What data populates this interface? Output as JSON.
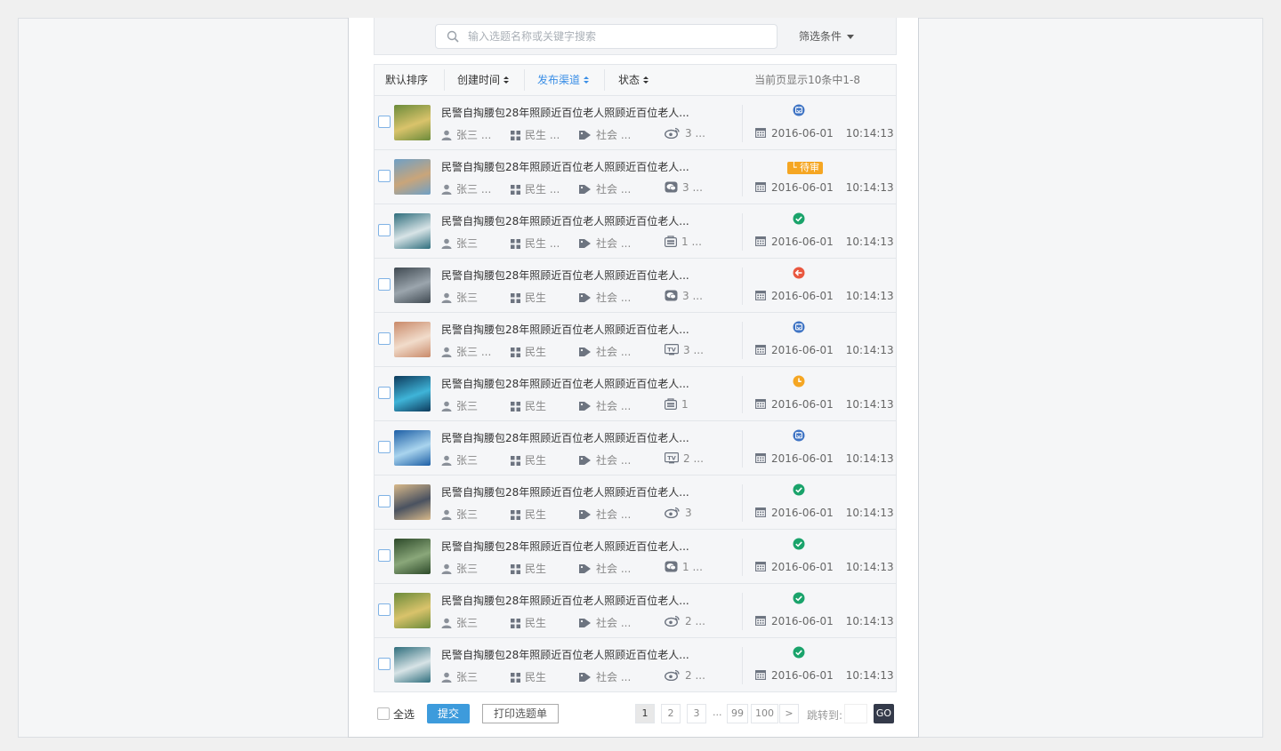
{
  "search": {
    "placeholder": "输入选题名称或关键字搜索"
  },
  "filter": {
    "label": "筛选条件"
  },
  "sort": {
    "default": "默认排序",
    "created": "创建时间",
    "channel": "发布渠道",
    "status": "状态",
    "page_info": "当前页显示10条中1-8"
  },
  "colors": {
    "accent": "#3d9bdc",
    "success": "#1aa36b",
    "warning": "#f5a623",
    "danger": "#e9573f",
    "info": "#3f74c4"
  },
  "rows": [
    {
      "title": "民警自掏腰包28年照顾近百位老人照顾近百位老人...",
      "author": "张三",
      "author_more": "...",
      "category": "民生",
      "category_more": "...",
      "tag": "社会",
      "tag_more": "...",
      "channel_icon": "weibo-icon",
      "channel_count": "3",
      "channel_more": "...",
      "status": "info",
      "status_label": "",
      "date": "2016-06-01",
      "time": "10:14:13",
      "thumb": [
        "#6b8b3a",
        "#d9c36b"
      ]
    },
    {
      "title": "民警自掏腰包28年照顾近百位老人照顾近百位老人...",
      "author": "张三",
      "author_more": "...",
      "category": "民生",
      "category_more": "...",
      "tag": "社会",
      "tag_more": "...",
      "channel_icon": "wechat-icon",
      "channel_count": "3",
      "channel_more": "...",
      "status": "pending",
      "status_label": "待审",
      "date": "2016-06-01",
      "time": "10:14:13",
      "thumb": [
        "#6fa0c6",
        "#c9a57a"
      ]
    },
    {
      "title": "民警自掏腰包28年照顾近百位老人照顾近百位老人...",
      "author": "张三",
      "author_more": "",
      "category": "民生",
      "category_more": "...",
      "tag": "社会",
      "tag_more": "...",
      "channel_icon": "app-icon",
      "channel_count": "1",
      "channel_more": "...",
      "status": "success",
      "status_label": "",
      "date": "2016-06-01",
      "time": "10:14:13",
      "thumb": [
        "#2f6e7d",
        "#d7e3e6"
      ]
    },
    {
      "title": "民警自掏腰包28年照顾近百位老人照顾近百位老人...",
      "author": "张三",
      "author_more": "",
      "category": "民生",
      "category_more": "",
      "tag": "社会",
      "tag_more": "...",
      "channel_icon": "wechat-icon",
      "channel_count": "3",
      "channel_more": "...",
      "status": "danger",
      "status_label": "",
      "date": "2016-06-01",
      "time": "10:14:13",
      "thumb": [
        "#404a52",
        "#9ba5ad"
      ]
    },
    {
      "title": "民警自掏腰包28年照顾近百位老人照顾近百位老人...",
      "author": "张三",
      "author_more": "...",
      "category": "民生",
      "category_more": "",
      "tag": "社会",
      "tag_more": "...",
      "channel_icon": "tv-icon",
      "channel_count": "3",
      "channel_more": "...",
      "status": "info",
      "status_label": "",
      "date": "2016-06-01",
      "time": "10:14:13",
      "thumb": [
        "#c98a6a",
        "#f1dccb"
      ]
    },
    {
      "title": "民警自掏腰包28年照顾近百位老人照顾近百位老人...",
      "author": "张三",
      "author_more": "",
      "category": "民生",
      "category_more": "",
      "tag": "社会",
      "tag_more": "...",
      "channel_icon": "app-icon",
      "channel_count": "1",
      "channel_more": "",
      "status": "clock",
      "status_label": "",
      "date": "2016-06-01",
      "time": "10:14:13",
      "thumb": [
        "#0d3a5c",
        "#3fb4d8"
      ]
    },
    {
      "title": "民警自掏腰包28年照顾近百位老人照顾近百位老人...",
      "author": "张三",
      "author_more": "",
      "category": "民生",
      "category_more": "",
      "tag": "社会",
      "tag_more": "...",
      "channel_icon": "tv-icon",
      "channel_count": "2",
      "channel_more": "...",
      "status": "info",
      "status_label": "",
      "date": "2016-06-01",
      "time": "10:14:13",
      "thumb": [
        "#1d5fa6",
        "#a9d4ee"
      ]
    },
    {
      "title": "民警自掏腰包28年照顾近百位老人照顾近百位老人...",
      "author": "张三",
      "author_more": "",
      "category": "民生",
      "category_more": "",
      "tag": "社会",
      "tag_more": "...",
      "channel_icon": "weibo-icon",
      "channel_count": "3",
      "channel_more": "",
      "status": "success",
      "status_label": "",
      "date": "2016-06-01",
      "time": "10:14:13",
      "thumb": [
        "#d8b98a",
        "#4a5260"
      ]
    },
    {
      "title": "民警自掏腰包28年照顾近百位老人照顾近百位老人...",
      "author": "张三",
      "author_more": "",
      "category": "民生",
      "category_more": "",
      "tag": "社会",
      "tag_more": "...",
      "channel_icon": "wechat-icon",
      "channel_count": "1",
      "channel_more": "...",
      "status": "success",
      "status_label": "",
      "date": "2016-06-01",
      "time": "10:14:13",
      "thumb": [
        "#2d4a2a",
        "#8aa77a"
      ]
    },
    {
      "title": "民警自掏腰包28年照顾近百位老人照顾近百位老人...",
      "author": "张三",
      "author_more": "",
      "category": "民生",
      "category_more": "",
      "tag": "社会",
      "tag_more": "...",
      "channel_icon": "weibo-icon",
      "channel_count": "2",
      "channel_more": "...",
      "status": "success",
      "status_label": "",
      "date": "2016-06-01",
      "time": "10:14:13",
      "thumb": [
        "#6b8b3a",
        "#d9c36b"
      ]
    },
    {
      "title": "民警自掏腰包28年照顾近百位老人照顾近百位老人...",
      "author": "张三",
      "author_more": "",
      "category": "民生",
      "category_more": "",
      "tag": "社会",
      "tag_more": "...",
      "channel_icon": "weibo-icon",
      "channel_count": "2",
      "channel_more": "...",
      "status": "success",
      "status_label": "",
      "date": "2016-06-01",
      "time": "10:14:13",
      "thumb": [
        "#2f6e7d",
        "#d7e3e6"
      ]
    }
  ],
  "footer": {
    "select_all": "全选",
    "submit": "提交",
    "print": "打印选题单",
    "pages": [
      "1",
      "2",
      "3",
      "...",
      "99",
      "100",
      ">"
    ],
    "jump_label": "跳转到:",
    "go": "GO"
  }
}
